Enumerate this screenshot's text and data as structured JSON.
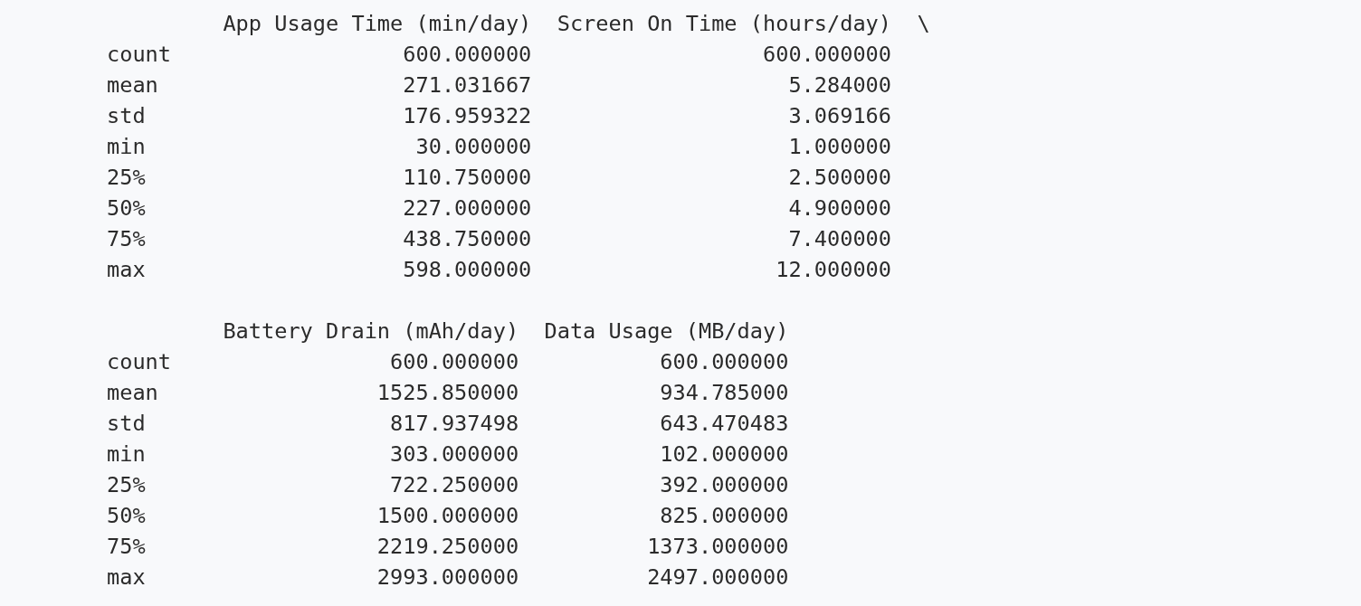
{
  "tables": [
    {
      "columns": [
        "App Usage Time (min/day)",
        "Screen On Time (hours/day)"
      ],
      "continuation": "\\",
      "rows": [
        {
          "label": "count",
          "values": [
            "600.000000",
            "600.000000"
          ]
        },
        {
          "label": "mean",
          "values": [
            "271.031667",
            "5.284000"
          ]
        },
        {
          "label": "std",
          "values": [
            "176.959322",
            "3.069166"
          ]
        },
        {
          "label": "min",
          "values": [
            "30.000000",
            "1.000000"
          ]
        },
        {
          "label": "25%",
          "values": [
            "110.750000",
            "2.500000"
          ]
        },
        {
          "label": "50%",
          "values": [
            "227.000000",
            "4.900000"
          ]
        },
        {
          "label": "75%",
          "values": [
            "438.750000",
            "7.400000"
          ]
        },
        {
          "label": "max",
          "values": [
            "598.000000",
            "12.000000"
          ]
        }
      ]
    },
    {
      "columns": [
        "Battery Drain (mAh/day)",
        "Data Usage (MB/day)"
      ],
      "rows": [
        {
          "label": "count",
          "values": [
            "600.000000",
            "600.000000"
          ]
        },
        {
          "label": "mean",
          "values": [
            "1525.850000",
            "934.785000"
          ]
        },
        {
          "label": "std",
          "values": [
            "817.937498",
            "643.470483"
          ]
        },
        {
          "label": "min",
          "values": [
            "303.000000",
            "102.000000"
          ]
        },
        {
          "label": "25%",
          "values": [
            "722.250000",
            "392.000000"
          ]
        },
        {
          "label": "50%",
          "values": [
            "1500.000000",
            "825.000000"
          ]
        },
        {
          "label": "75%",
          "values": [
            "2219.250000",
            "1373.000000"
          ]
        },
        {
          "label": "max",
          "values": [
            "2993.000000",
            "2497.000000"
          ]
        }
      ]
    }
  ]
}
